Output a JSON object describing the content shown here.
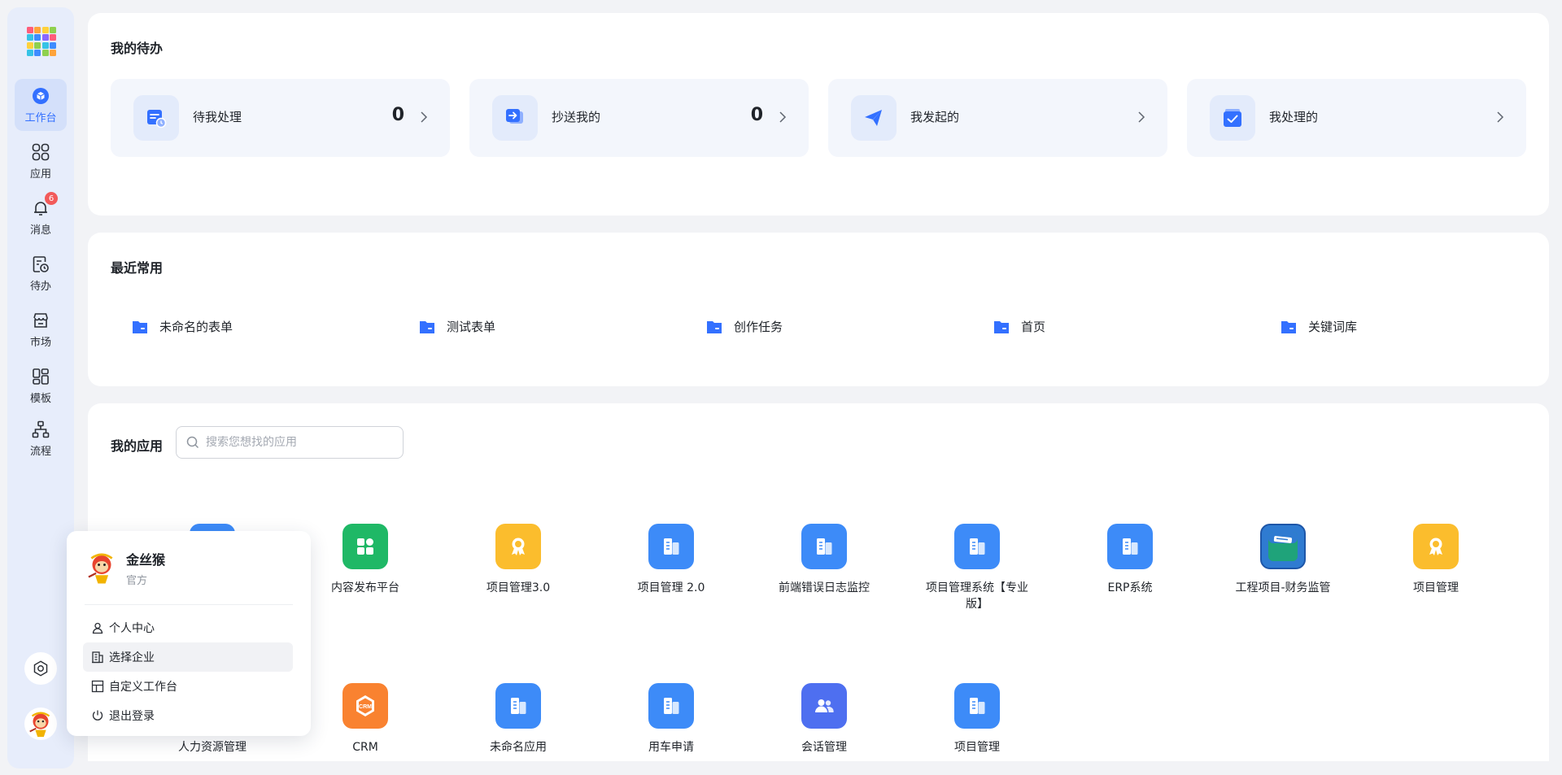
{
  "sidebar": {
    "items": [
      {
        "label": "工作台",
        "icon": "workbench-icon",
        "active": true
      },
      {
        "label": "应用",
        "icon": "apps-grid-icon"
      },
      {
        "label": "消息",
        "icon": "bell-icon",
        "badge": "6"
      },
      {
        "label": "待办",
        "icon": "todo-clock-icon"
      },
      {
        "label": "市场",
        "icon": "store-icon"
      },
      {
        "label": "模板",
        "icon": "template-icon"
      },
      {
        "label": "流程",
        "icon": "flow-icon"
      }
    ]
  },
  "todo": {
    "title": "我的待办",
    "tiles": [
      {
        "label": "待我处理",
        "count": "0"
      },
      {
        "label": "抄送我的",
        "count": "0"
      },
      {
        "label": "我发起的",
        "count": ""
      },
      {
        "label": "我处理的",
        "count": ""
      }
    ]
  },
  "recent": {
    "title": "最近常用",
    "items": [
      {
        "label": "未命名的表单"
      },
      {
        "label": "测试表单"
      },
      {
        "label": "创作任务"
      },
      {
        "label": "首页"
      },
      {
        "label": "关键词库"
      }
    ]
  },
  "apps": {
    "title": "我的应用",
    "search_placeholder": "搜索您想找的应用",
    "items": [
      {
        "label": "",
        "icon": "building-icon",
        "color": "#3d8bf8"
      },
      {
        "label": "内容发布平台",
        "icon": "blocks-icon",
        "color": "#1fb866"
      },
      {
        "label": "项目管理3.0",
        "icon": "award-icon",
        "color": "#fbbd2d"
      },
      {
        "label": "项目管理 2.0",
        "icon": "building-icon",
        "color": "#3d8bf8"
      },
      {
        "label": "前端错误日志监控",
        "icon": "building-icon",
        "color": "#3d8bf8"
      },
      {
        "label": "项目管理系统【专业版】",
        "icon": "building-icon",
        "color": "#3d8bf8"
      },
      {
        "label": "ERP系统",
        "icon": "building-icon",
        "color": "#3d8bf8"
      },
      {
        "label": "工程项目-财务监管",
        "icon": "image-icon",
        "color": "#2f7bd1"
      },
      {
        "label": "项目管理",
        "icon": "award-icon",
        "color": "#fbbd2d"
      },
      {
        "label": "人力资源管理",
        "icon": "building-icon",
        "color": "#3d8bf8"
      },
      {
        "label": "CRM",
        "icon": "crm-icon",
        "color": "#f98230"
      },
      {
        "label": "未命名应用",
        "icon": "building-icon",
        "color": "#3d8bf8"
      },
      {
        "label": "用车申请",
        "icon": "building-icon",
        "color": "#3d8bf8"
      },
      {
        "label": "会话管理",
        "icon": "users-icon",
        "color": "#4e6ff0"
      },
      {
        "label": "项目管理",
        "icon": "building-icon",
        "color": "#3d8bf8"
      }
    ]
  },
  "popover": {
    "name": "金丝猴",
    "subtitle": "官方",
    "items": [
      {
        "label": "个人中心"
      },
      {
        "label": "选择企业"
      },
      {
        "label": "自定义工作台"
      },
      {
        "label": "退出登录"
      }
    ]
  },
  "colors": {
    "accent": "#3370ff",
    "sidebar_bg": "#e7edfb",
    "badge": "#f25a5a"
  }
}
